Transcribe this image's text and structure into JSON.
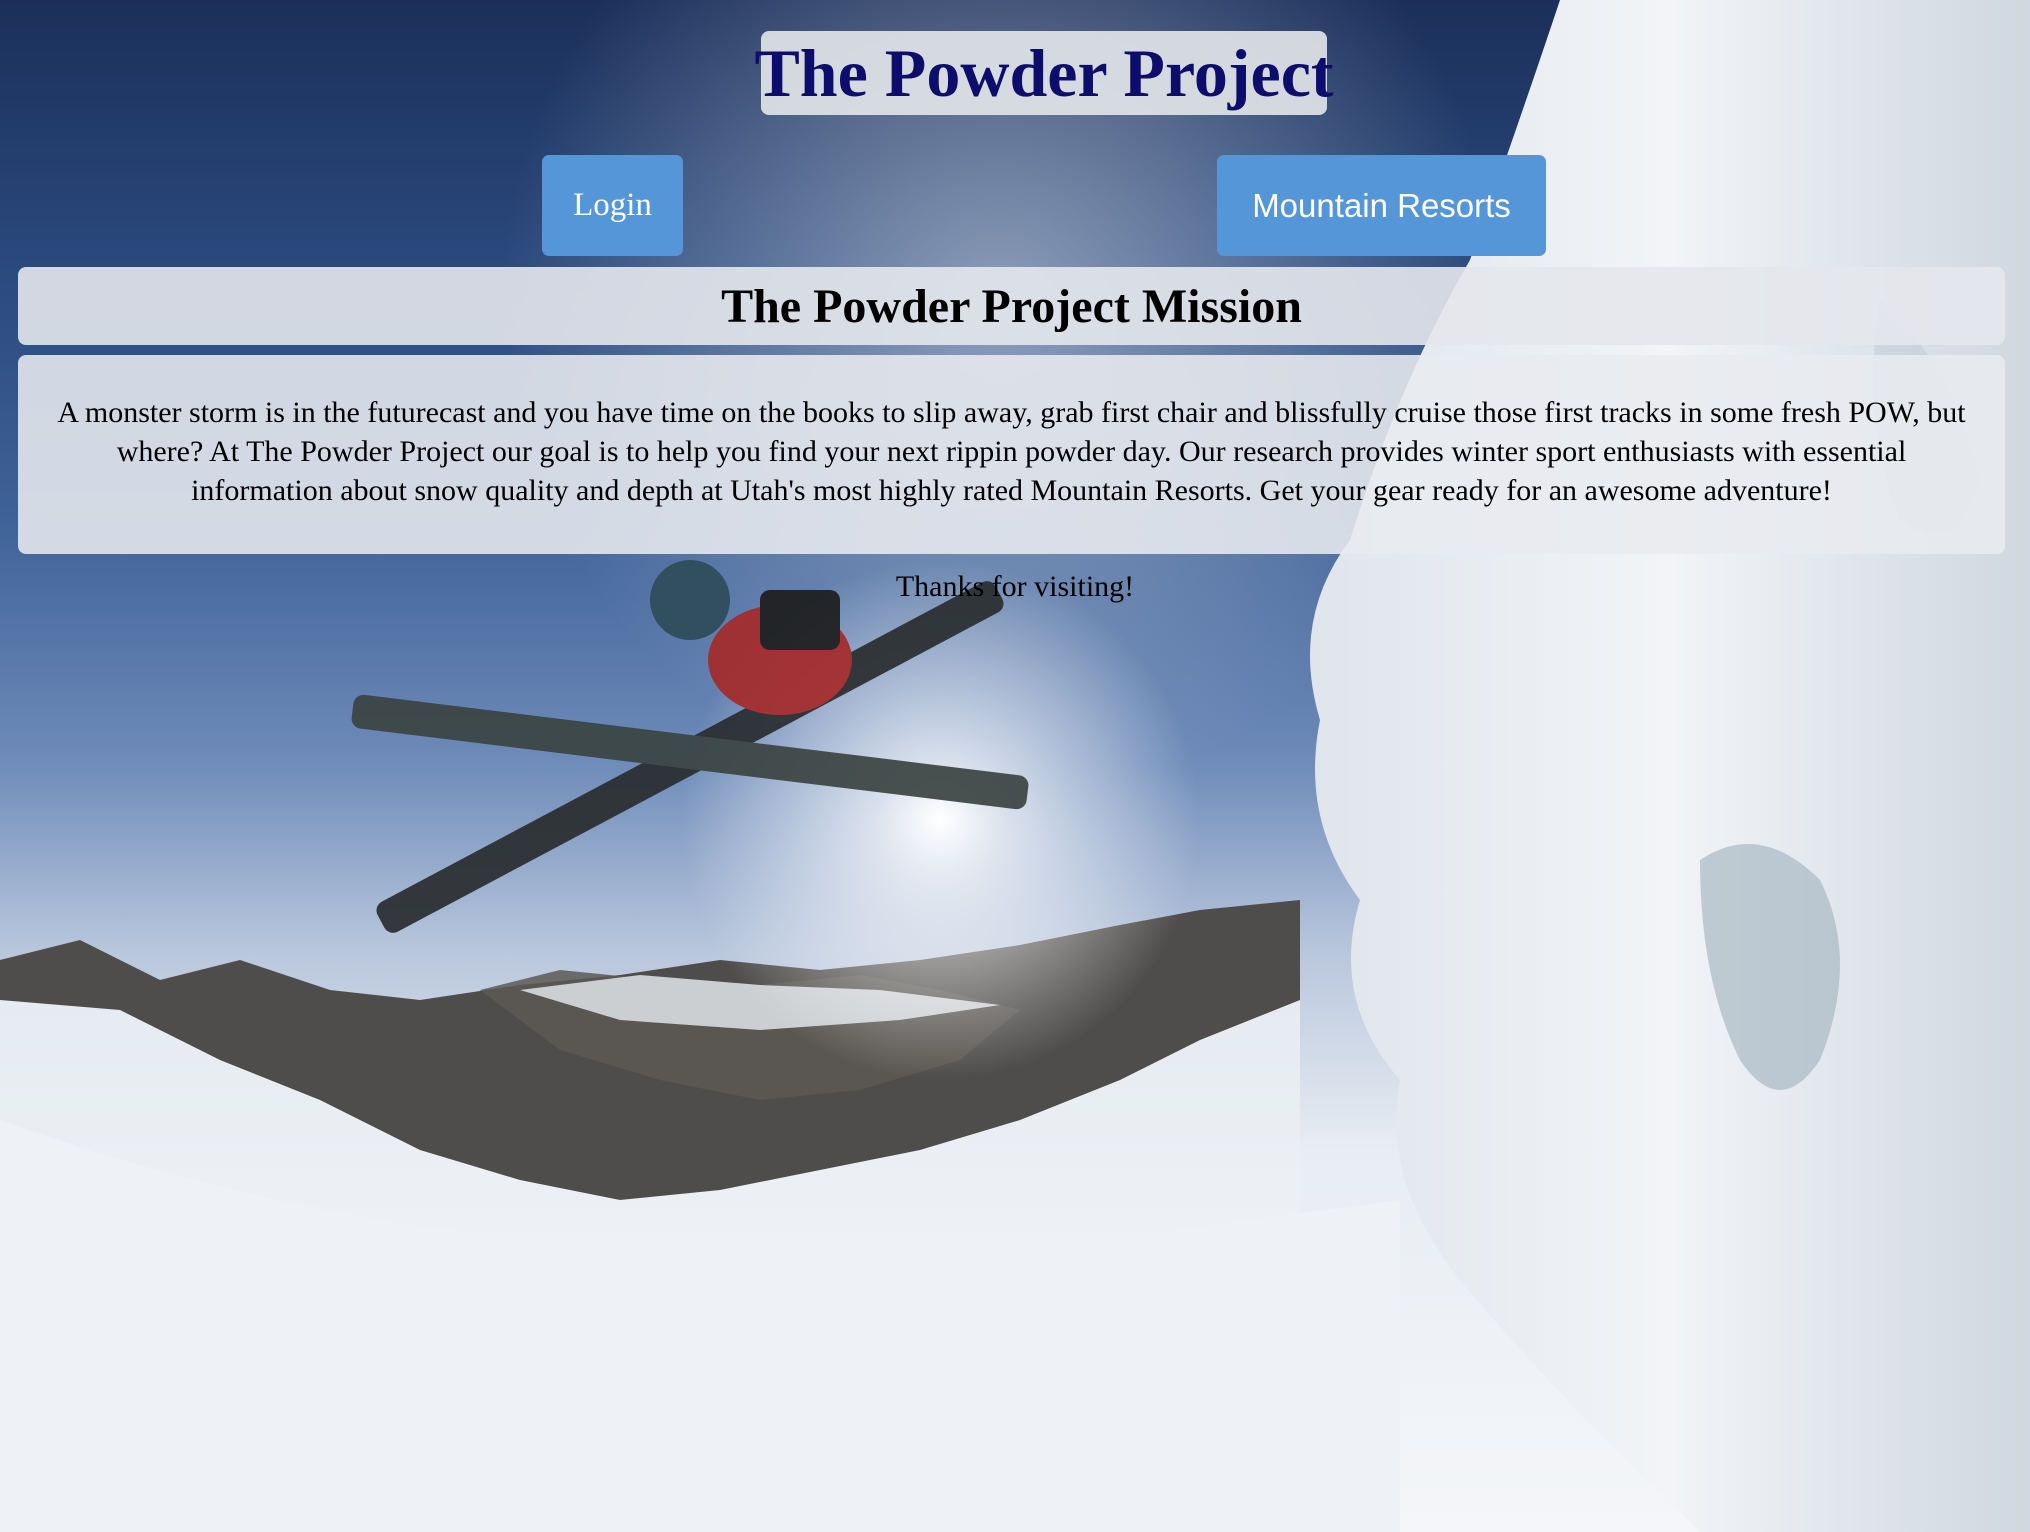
{
  "header": {
    "title": "The Powder Project"
  },
  "nav": {
    "login_label": "Login",
    "resorts_label": "Mountain Resorts"
  },
  "mission": {
    "heading": "The Powder Project Mission",
    "body": "A monster storm is in the futurecast and you have time on the books to slip away, grab first chair and blissfully cruise those first tracks in some fresh POW, but where? At The Powder Project our goal is to help you find your next rippin powder day. Our research provides winter sport enthusiasts with essential information about snow quality and depth at Utah's most highly rated Mountain Resorts. Get your gear ready for an awesome adventure!"
  },
  "footer": {
    "thanks": "Thanks for visiting!"
  },
  "colors": {
    "title_text": "#0d0d6b",
    "button_bg": "#5596d8",
    "button_text": "#ffffff",
    "panel_bg": "#e4e7ec"
  },
  "background": {
    "icon": "ski-jump-photo"
  }
}
